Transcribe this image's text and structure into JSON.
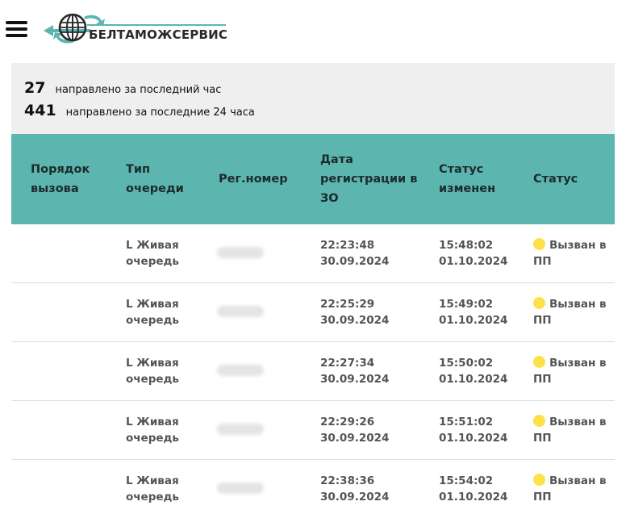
{
  "header": {
    "logo_text": "БЕЛТАМОЖСЕРВИС",
    "menu_icon": "hamburger-menu-icon",
    "colors": {
      "logo_teal": "#5db5b0",
      "logo_dark": "#2a2a2a"
    }
  },
  "stats": {
    "last_hour": {
      "value": "27",
      "label": "направлено за последний час"
    },
    "last_day": {
      "value": "441",
      "label": "направлено за последние 24 часа"
    }
  },
  "table": {
    "header_color": "#5db5b0",
    "columns": {
      "order": "Порядок вызова",
      "type": "Тип очереди",
      "reg": "Рег.номер",
      "date": "Дата регистрации в ЗО",
      "changed": "Статус изменен",
      "status": "Статус"
    },
    "rows": [
      {
        "type": "L Живая очередь",
        "reg_time": "22:23:48",
        "reg_date": "30.09.2024",
        "changed_time": "15:48:02",
        "changed_date": "01.10.2024",
        "status": "Вызван в ПП"
      },
      {
        "type": "L Живая очередь",
        "reg_time": "22:25:29",
        "reg_date": "30.09.2024",
        "changed_time": "15:49:02",
        "changed_date": "01.10.2024",
        "status": "Вызван в ПП"
      },
      {
        "type": "L Живая очередь",
        "reg_time": "22:27:34",
        "reg_date": "30.09.2024",
        "changed_time": "15:50:02",
        "changed_date": "01.10.2024",
        "status": "Вызван в ПП"
      },
      {
        "type": "L Живая очередь",
        "reg_time": "22:29:26",
        "reg_date": "30.09.2024",
        "changed_time": "15:51:02",
        "changed_date": "01.10.2024",
        "status": "Вызван в ПП"
      },
      {
        "type": "L Живая очередь",
        "reg_time": "22:38:36",
        "reg_date": "30.09.2024",
        "changed_time": "15:54:02",
        "changed_date": "01.10.2024",
        "status": "Вызван в ПП"
      }
    ],
    "status_dot_color": "#fde14a"
  }
}
